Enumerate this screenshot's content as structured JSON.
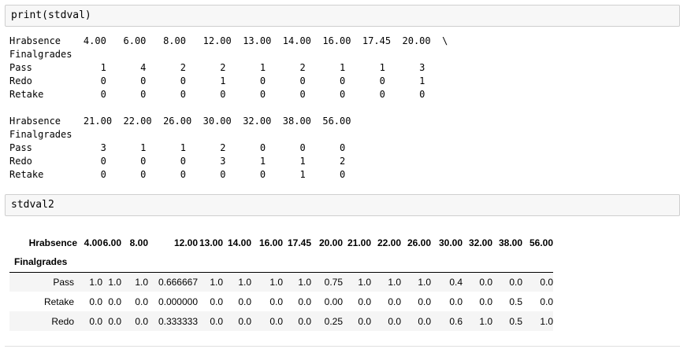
{
  "cells": [
    {
      "code": "print(stdval)"
    },
    {
      "code": "stdval2"
    }
  ],
  "text_output": {
    "lines": [
      "Hrabsence    4.00   6.00   8.00   12.00  13.00  14.00  16.00  17.45  20.00  \\",
      "Finalgrades",
      "Pass            1      4      2      2      1      2      1      1      3",
      "Redo            0      0      0      1      0      0      0      0      1",
      "Retake          0      0      0      0      0      0      0      0      0",
      "",
      "Hrabsence    21.00  22.00  26.00  30.00  32.00  38.00  56.00",
      "Finalgrades",
      "Pass            3      1      1      2      0      0      0",
      "Redo            0      0      0      3      1      1      2",
      "Retake          0      0      0      0      0      1      0"
    ]
  },
  "dataframe": {
    "columns_name": "Hrabsence",
    "index_name": "Finalgrades",
    "columns": [
      "4.00",
      "6.00",
      "8.00",
      "12.00",
      "13.00",
      "14.00",
      "16.00",
      "17.45",
      "20.00",
      "21.00",
      "22.00",
      "26.00",
      "30.00",
      "32.00",
      "38.00",
      "56.00"
    ],
    "rows": [
      {
        "label": "Pass",
        "values": [
          "1.0",
          "1.0",
          "1.0",
          "0.666667",
          "1.0",
          "1.0",
          "1.0",
          "1.0",
          "0.75",
          "1.0",
          "1.0",
          "1.0",
          "0.4",
          "0.0",
          "0.0",
          "0.0"
        ]
      },
      {
        "label": "Retake",
        "values": [
          "0.0",
          "0.0",
          "0.0",
          "0.000000",
          "0.0",
          "0.0",
          "0.0",
          "0.0",
          "0.00",
          "0.0",
          "0.0",
          "0.0",
          "0.0",
          "0.0",
          "0.5",
          "0.0"
        ]
      },
      {
        "label": "Redo",
        "values": [
          "0.0",
          "0.0",
          "0.0",
          "0.333333",
          "0.0",
          "0.0",
          "0.0",
          "0.0",
          "0.25",
          "0.0",
          "0.0",
          "0.0",
          "0.6",
          "1.0",
          "0.5",
          "1.0"
        ]
      }
    ]
  }
}
